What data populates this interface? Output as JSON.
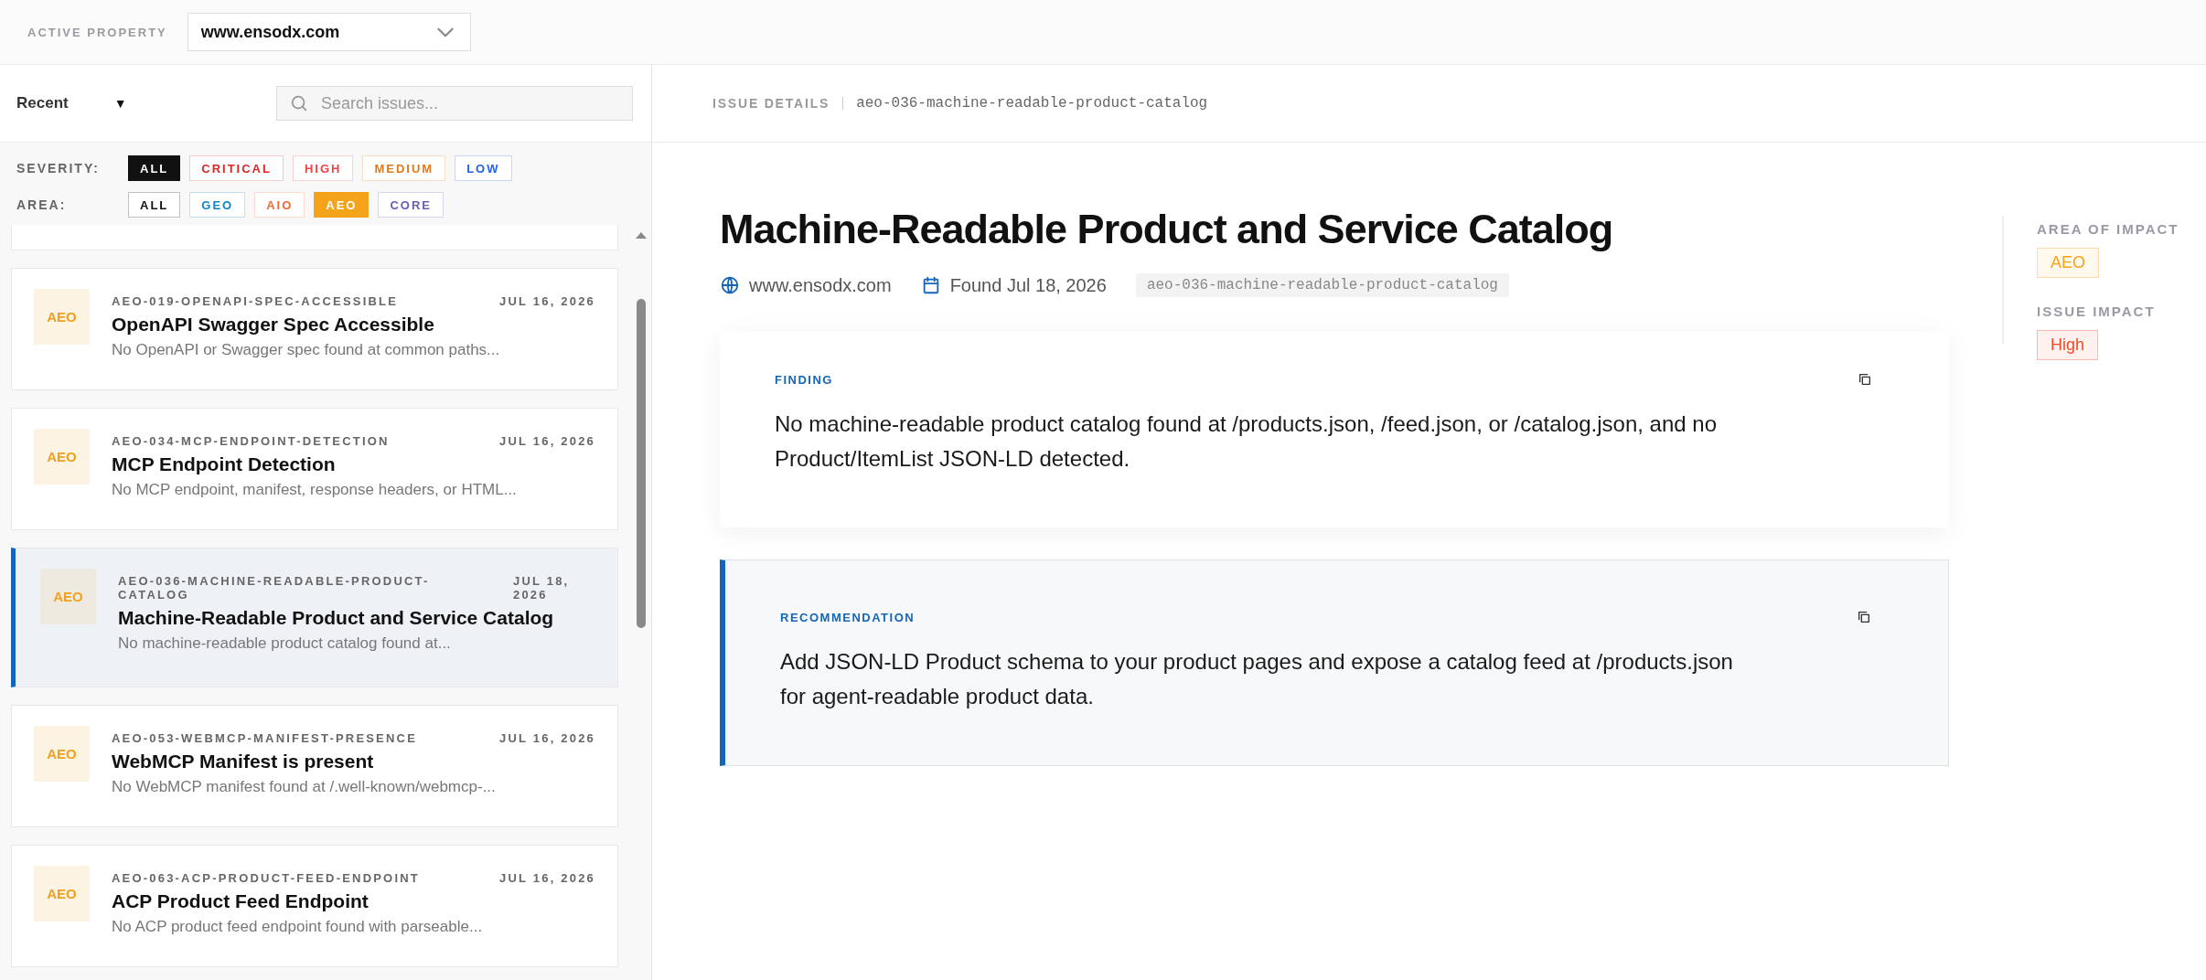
{
  "header": {
    "label": "ACTIVE PROPERTY",
    "property": {
      "value": "www.ensodx.com"
    }
  },
  "sidebar": {
    "sort": {
      "label": "Recent",
      "caret": "▼"
    },
    "search": {
      "placeholder": "Search issues..."
    },
    "filters": [
      {
        "label": "SEVERITY:",
        "chips": [
          {
            "label": "ALL",
            "color": "#111111",
            "selected": true
          },
          {
            "label": "CRITICAL",
            "color": "#dc2626",
            "selected": false
          },
          {
            "label": "HIGH",
            "color": "#ef4444",
            "selected": false
          },
          {
            "label": "MEDIUM",
            "color": "#e07a1f",
            "selected": false
          },
          {
            "label": "LOW",
            "color": "#2563eb",
            "selected": false
          }
        ]
      },
      {
        "label": "AREA:",
        "chips": [
          {
            "label": "ALL",
            "color": "#111111",
            "selected": false
          },
          {
            "label": "GEO",
            "color": "#0e86c4",
            "selected": false
          },
          {
            "label": "AIO",
            "color": "#f06a35",
            "selected": false
          },
          {
            "label": "AEO",
            "color": "#f5a31a",
            "selected": true
          },
          {
            "label": "CORE",
            "color": "#6b5bb5",
            "selected": false
          }
        ]
      }
    ],
    "issues": [
      {
        "badge": "AEO",
        "id": "AEO-019-OPENAPI-SPEC-ACCESSIBLE",
        "date": "JUL 16, 2026",
        "title": "OpenAPI Swagger Spec Accessible",
        "snippet": "No OpenAPI or Swagger spec found at common paths...",
        "selected": false
      },
      {
        "badge": "AEO",
        "id": "AEO-034-MCP-ENDPOINT-DETECTION",
        "date": "JUL 16, 2026",
        "title": "MCP Endpoint Detection",
        "snippet": "No MCP endpoint, manifest, response headers, or HTML...",
        "selected": false
      },
      {
        "badge": "AEO",
        "id": "AEO-036-MACHINE-READABLE-PRODUCT-CATALOG",
        "date": "JUL 18, 2026",
        "title": "Machine-Readable Product and Service Catalog",
        "snippet": "No machine-readable product catalog found at...",
        "selected": true
      },
      {
        "badge": "AEO",
        "id": "AEO-053-WEBMCP-MANIFEST-PRESENCE",
        "date": "JUL 16, 2026",
        "title": "WebMCP Manifest is present",
        "snippet": "No WebMCP manifest found at /.well-known/webmcp-...",
        "selected": false
      },
      {
        "badge": "AEO",
        "id": "AEO-063-ACP-PRODUCT-FEED-ENDPOINT",
        "date": "JUL 16, 2026",
        "title": "ACP Product Feed Endpoint",
        "snippet": "No ACP product feed endpoint found with parseable...",
        "selected": false
      }
    ]
  },
  "detail": {
    "breadcrumb": {
      "label": "ISSUE DETAILS",
      "slug": "aeo-036-machine-readable-product-catalog"
    },
    "title": "Machine-Readable Product and Service Catalog",
    "meta": {
      "site": "www.ensodx.com",
      "found": "Found Jul 18, 2026",
      "slug": "aeo-036-machine-readable-product-catalog"
    },
    "finding": {
      "label": "FINDING",
      "text": "No machine-readable product catalog found at /products.json, /feed.json, or /catalog.json, and no Product/ItemList JSON-LD detected."
    },
    "recommendation": {
      "label": "RECOMMENDATION",
      "text": "Add JSON-LD Product schema to your product pages and expose a catalog feed at /products.json for agent-readable product data."
    },
    "aside": [
      {
        "label": "AREA OF IMPACT",
        "value": "AEO",
        "color": "#f5a31a"
      },
      {
        "label": "ISSUE IMPACT",
        "value": "High",
        "color": "#ef4a2a"
      }
    ]
  }
}
